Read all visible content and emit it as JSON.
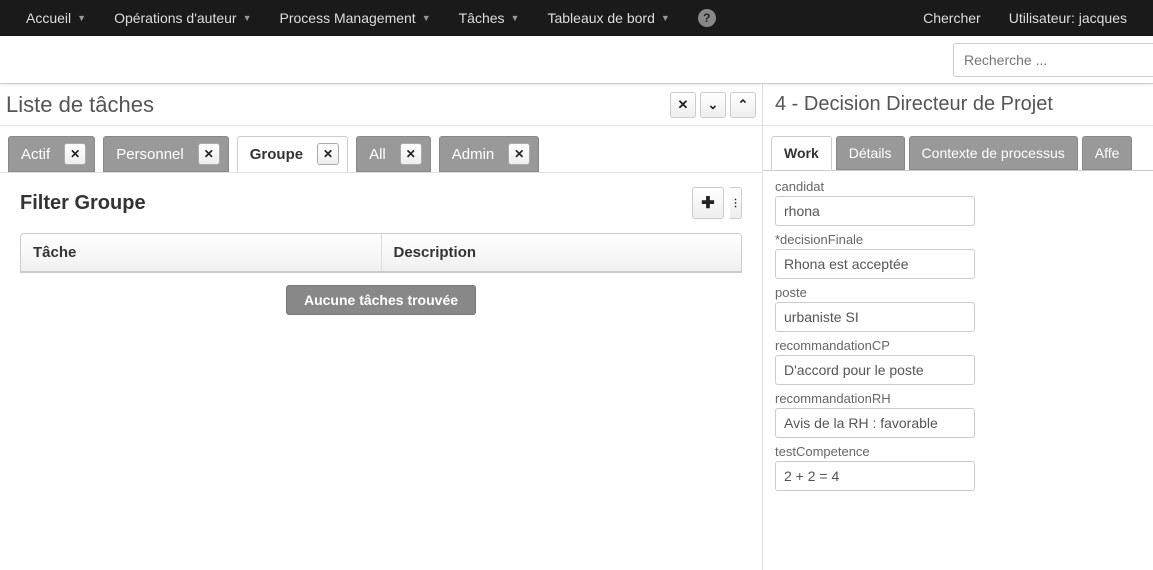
{
  "nav": {
    "items": [
      {
        "label": "Accueil"
      },
      {
        "label": "Opérations d'auteur"
      },
      {
        "label": "Process Management"
      },
      {
        "label": "Tâches"
      },
      {
        "label": "Tableaux de bord"
      }
    ],
    "search_label": "Chercher",
    "user_label": "Utilisateur: jacques"
  },
  "subbar": {
    "search_placeholder": "Recherche ..."
  },
  "left_panel": {
    "title": "Liste de tâches",
    "tabs": [
      {
        "label": "Actif"
      },
      {
        "label": "Personnel"
      },
      {
        "label": "Groupe"
      },
      {
        "label": "All"
      },
      {
        "label": "Admin"
      }
    ],
    "filter_title": "Filter Groupe",
    "table": {
      "col1": "Tâche",
      "col2": "Description",
      "empty": "Aucune tâches trouvée"
    }
  },
  "right_panel": {
    "title": "4 - Decision Directeur de Projet",
    "tabs": [
      {
        "label": "Work"
      },
      {
        "label": "Détails"
      },
      {
        "label": "Contexte de processus"
      },
      {
        "label": "Affe"
      }
    ],
    "form": [
      {
        "label": "candidat",
        "value": "rhona"
      },
      {
        "label": "*decisionFinale",
        "value": "Rhona est acceptée"
      },
      {
        "label": "poste",
        "value": "urbaniste SI"
      },
      {
        "label": "recommandationCP",
        "value": "D'accord pour le poste"
      },
      {
        "label": "recommandationRH",
        "value": "Avis de la RH : favorable"
      },
      {
        "label": "testCompetence",
        "value": "2 + 2 = 4"
      }
    ]
  }
}
